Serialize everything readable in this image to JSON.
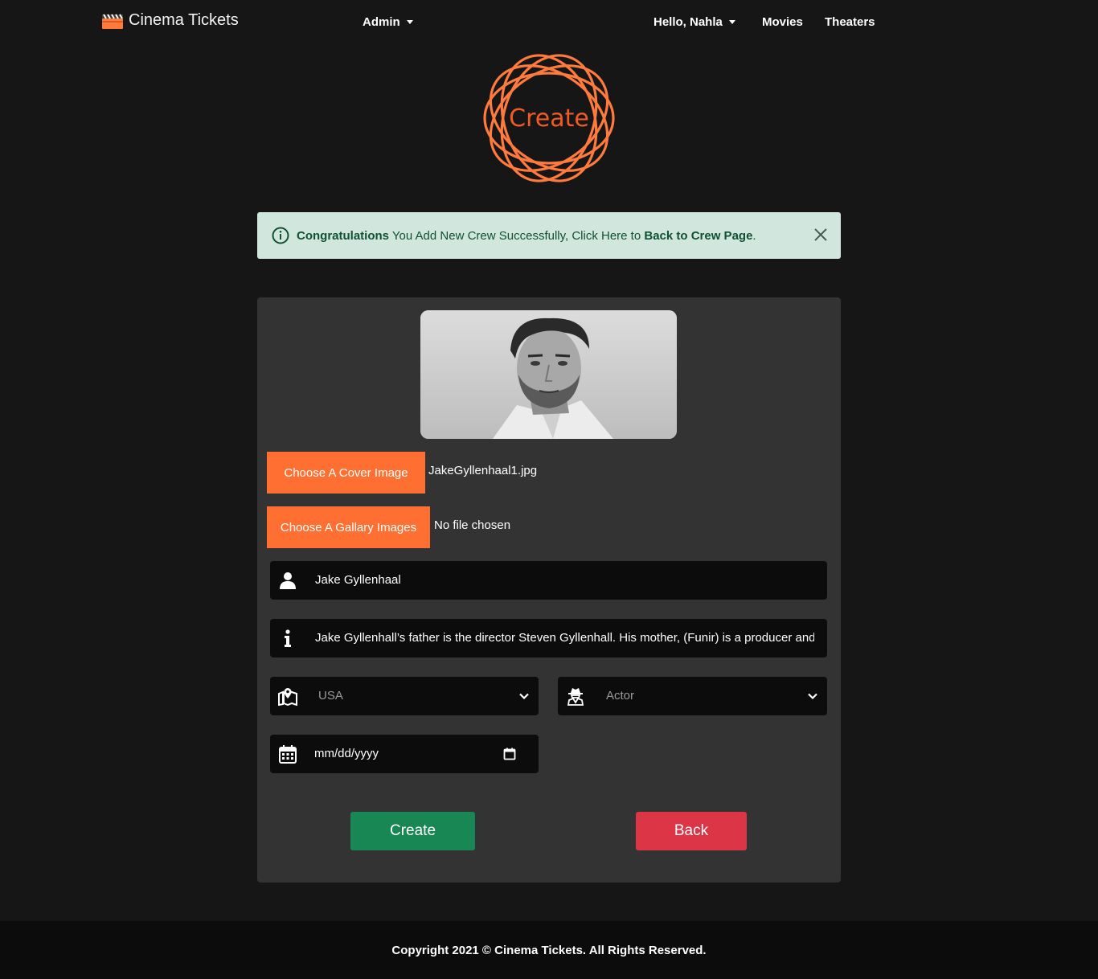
{
  "navbar": {
    "brand": "Cinema Tickets",
    "admin_label": "Admin",
    "user_label": "Hello, Nahla",
    "movies_label": "Movies",
    "theaters_label": "Theaters"
  },
  "logo": {
    "text": "Create",
    "color": "#f15a22"
  },
  "alert": {
    "strong": "Congratulations",
    "message": " You Add New Crew Successfully, Click Here to ",
    "link": "Back to Crew Page",
    "end": "."
  },
  "form": {
    "cover_button": "Choose A Cover Image",
    "cover_file": "JakeGyllenhaal1.jpg",
    "gallery_button": "Choose A Gallary Images",
    "gallery_file": "No file chosen",
    "name_value": "Jake Gyllenhaal",
    "bio_value": "Jake Gyllenhall’s father is the director Steven Gyllenhall. His mother, (Funir) is a producer and screenwriter.",
    "country_value": "USA",
    "role_value": "Actor",
    "date_placeholder": "mm/dd/yyyy",
    "create_label": "Create",
    "back_label": "Back"
  },
  "footer": {
    "text": "Copyright 2021 © Cinema Tickets. All Rights Reserved."
  },
  "colors": {
    "accent": "#ff6f31",
    "alert_bg": "#d1e7dd",
    "create": "#198754",
    "back": "#dc3545"
  }
}
